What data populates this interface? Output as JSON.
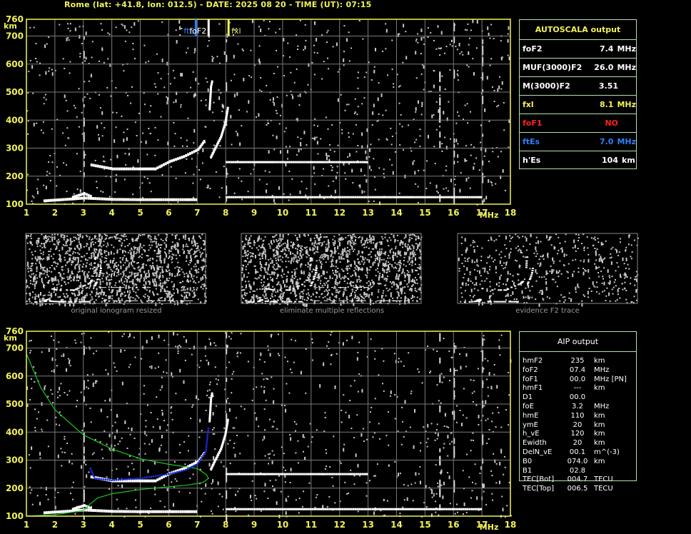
{
  "header": "Rome (lat: +41.8, lon: 012.5) - DATE: 2025 08 20 - TIME (UT): 07:15",
  "colors": {
    "axis": "#f2f25a",
    "grid": "#7a7a7a",
    "table_border": "#b6e0b0",
    "blue": "#2f7fff",
    "red": "#ff2020",
    "green": "#1ec81e",
    "fit": "#1a28d8"
  },
  "autoscala": {
    "title": "AUTOSCALA output",
    "rows": [
      {
        "label": "foF2",
        "value": "7.4",
        "unit": "MHz",
        "color": "#ffffff"
      },
      {
        "label": "MUF(3000)F2",
        "value": "26.0",
        "unit": "MHz",
        "color": "#ffffff"
      },
      {
        "label": "M(3000)F2",
        "value": "3.51",
        "unit": "",
        "color": "#ffffff"
      },
      {
        "label": "fxl",
        "value": "8.1",
        "unit": "MHz",
        "color": "#f2f25a"
      },
      {
        "label": "foF1",
        "value": "NO",
        "unit": "",
        "color": "#ff2020"
      },
      {
        "label": "ftEs",
        "value": "7.0",
        "unit": "MHz",
        "color": "#2f7fff"
      },
      {
        "label": "h'Es",
        "value": "104",
        "unit": "km",
        "color": "#ffffff"
      }
    ]
  },
  "aip": {
    "title": "AIP output",
    "rows": [
      [
        "hmF2",
        "235",
        "km"
      ],
      [
        "foF2",
        "07.4",
        "MHz"
      ],
      [
        "foF1",
        "00.0",
        "MHz   [PN]"
      ],
      [
        "hmF1",
        "---",
        "km"
      ],
      [
        "D1",
        "00.0",
        ""
      ],
      [
        "foE",
        "3.2",
        "MHz"
      ],
      [
        "hmE",
        "110",
        "km"
      ],
      [
        "ymE",
        "20",
        "km"
      ],
      [
        "h_vE",
        "120",
        "km"
      ],
      [
        "Ewidth",
        "20",
        "km"
      ],
      [
        "DelN_vE",
        "00.1",
        "m^(-3)"
      ],
      [
        "B0",
        "074.0",
        "km"
      ],
      [
        "B1",
        "02.8",
        ""
      ],
      [
        "TEC[Bot]",
        "004.7",
        "TECU"
      ],
      [
        "TEC[Top]",
        "006.5",
        "TECU"
      ]
    ]
  },
  "captions": [
    "original ionogram resized",
    "eliminate multiple reflections",
    "evidence F2 trace"
  ],
  "chart_data": {
    "type": "scatter",
    "xlabel": "MHz",
    "ylabel": "km",
    "xlim": [
      1,
      18
    ],
    "ylim": [
      100,
      760
    ],
    "xticks": [
      1,
      2,
      3,
      4,
      5,
      6,
      7,
      8,
      9,
      10,
      11,
      12,
      13,
      14,
      15,
      16,
      17,
      18
    ],
    "yticks": [
      100,
      200,
      300,
      400,
      500,
      600,
      700,
      760
    ],
    "markers": [
      {
        "label": "ftE",
        "color": "#2f7fff",
        "x": 6.95
      },
      {
        "label": "foF2",
        "color": "#ffffff",
        "x": 7.4
      },
      {
        "label": "fxl",
        "color": "#f2f25a",
        "x": 8.1
      }
    ],
    "traces": {
      "es": [
        [
          1.6,
          112
        ],
        [
          2.5,
          118
        ],
        [
          3.0,
          122
        ],
        [
          4,
          117
        ],
        [
          5,
          116
        ],
        [
          6,
          116
        ],
        [
          7,
          116
        ]
      ],
      "es_bump": [
        [
          2.6,
          125
        ],
        [
          3.0,
          138
        ],
        [
          3.3,
          125
        ]
      ],
      "f2_ordinary": [
        [
          3.25,
          240
        ],
        [
          4,
          226
        ],
        [
          5,
          226
        ],
        [
          5.5,
          226
        ],
        [
          6.0,
          252
        ],
        [
          6.5,
          270
        ],
        [
          7.0,
          295
        ],
        [
          7.25,
          330
        ]
      ],
      "f2_extra": [
        [
          7.45,
          268
        ],
        [
          7.6,
          300
        ],
        [
          7.8,
          340
        ],
        [
          7.95,
          390
        ],
        [
          8.05,
          450
        ]
      ],
      "f2_upper": [
        [
          7.4,
          440
        ],
        [
          7.45,
          520
        ],
        [
          7.5,
          545
        ]
      ],
      "second_hop": [
        [
          8,
          125
        ],
        [
          12,
          125
        ],
        [
          16,
          125
        ],
        [
          17,
          125
        ]
      ],
      "second_hop_f": [
        [
          8,
          250
        ],
        [
          9.5,
          250
        ],
        [
          12,
          250
        ],
        [
          13,
          250
        ]
      ]
    },
    "green_profile": [
      [
        1,
        680
      ],
      [
        1.5,
        560
      ],
      [
        2,
        480
      ],
      [
        3,
        390
      ],
      [
        4,
        340
      ],
      [
        5,
        305
      ],
      [
        6,
        285
      ],
      [
        7,
        270
      ],
      [
        7.3,
        250
      ],
      [
        7.4,
        235
      ],
      [
        7.2,
        220
      ],
      [
        6.6,
        210
      ],
      [
        6,
        205
      ],
      [
        5,
        195
      ],
      [
        4,
        180
      ],
      [
        3.5,
        165
      ],
      [
        3.2,
        140
      ],
      [
        3.0,
        120
      ],
      [
        2,
        105
      ],
      [
        1,
        100
      ]
    ],
    "blue_fit": [
      [
        3.25,
        270
      ],
      [
        3.4,
        235
      ],
      [
        4,
        228
      ],
      [
        5,
        235
      ],
      [
        6,
        250
      ],
      [
        6.6,
        265
      ],
      [
        7.0,
        285
      ],
      [
        7.3,
        330
      ],
      [
        7.4,
        420
      ]
    ]
  }
}
